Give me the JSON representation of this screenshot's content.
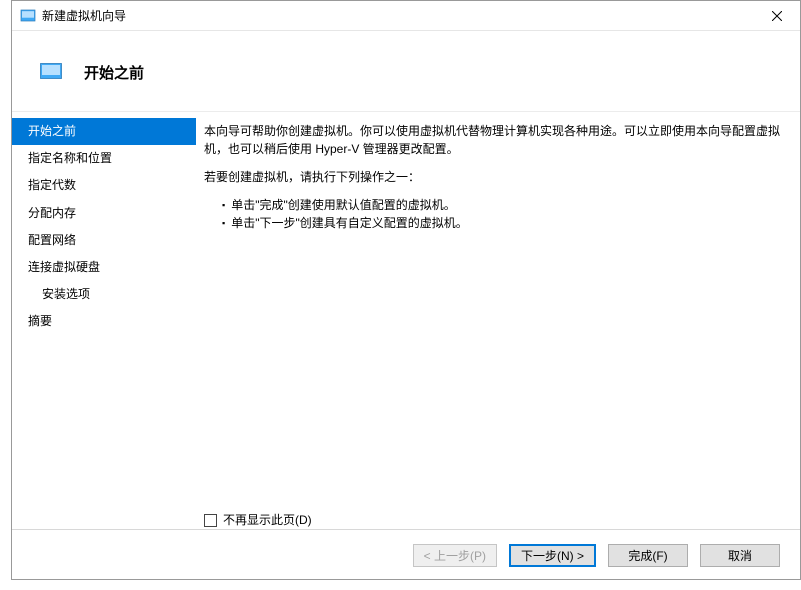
{
  "titlebar": {
    "title": "新建虚拟机向导"
  },
  "header": {
    "title": "开始之前"
  },
  "sidebar": {
    "items": [
      {
        "label": "开始之前",
        "selected": true
      },
      {
        "label": "指定名称和位置"
      },
      {
        "label": "指定代数"
      },
      {
        "label": "分配内存"
      },
      {
        "label": "配置网络"
      },
      {
        "label": "连接虚拟硬盘"
      },
      {
        "label": "安装选项",
        "indent": true
      },
      {
        "label": "摘要"
      }
    ]
  },
  "main": {
    "intro": "本向导可帮助你创建虚拟机。你可以使用虚拟机代替物理计算机实现各种用途。可以立即使用本向导配置虚拟机，也可以稍后使用 Hyper-V 管理器更改配置。",
    "prompt": "若要创建虚拟机，请执行下列操作之一：",
    "bullets": [
      "单击\"完成\"创建使用默认值配置的虚拟机。",
      "单击\"下一步\"创建具有自定义配置的虚拟机。"
    ],
    "checkbox_label": "不再显示此页(D)"
  },
  "footer": {
    "back": "< 上一步(P)",
    "next": "下一步(N) >",
    "finish": "完成(F)",
    "cancel": "取消"
  }
}
